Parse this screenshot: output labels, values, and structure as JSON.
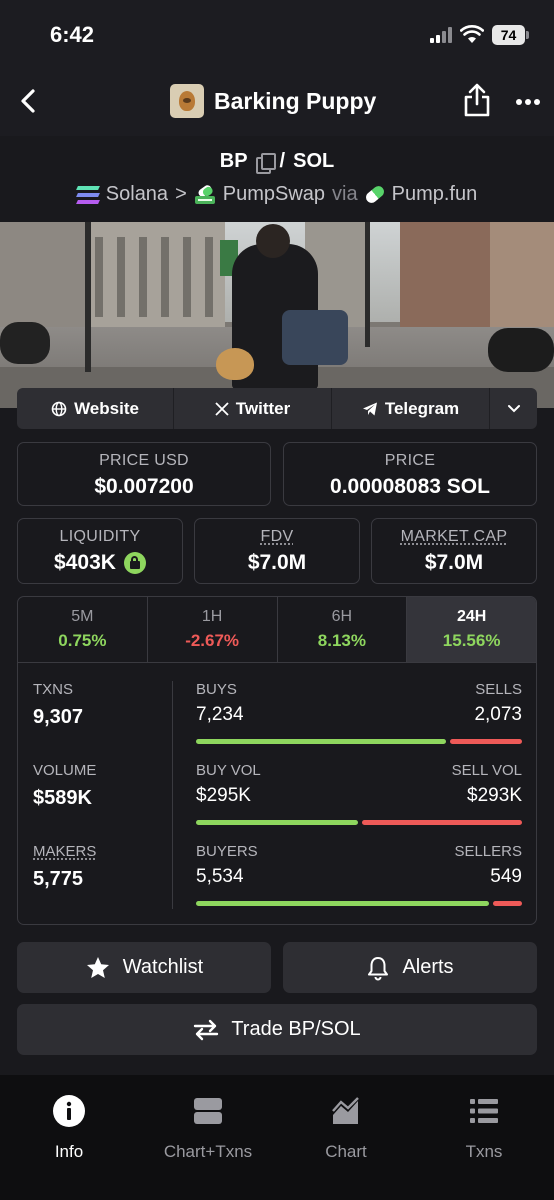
{
  "status_bar": {
    "time": "6:42",
    "battery": "74"
  },
  "nav": {
    "token_name": "Barking Puppy"
  },
  "pair": {
    "base": "BP",
    "separator": "/",
    "quote": "SOL",
    "chain": "Solana",
    "route_sep": ">",
    "dex": "PumpSwap",
    "via": "via",
    "launchpad": "Pump.fun"
  },
  "links": [
    {
      "label": "Website",
      "icon": "globe-icon"
    },
    {
      "label": "Twitter",
      "icon": "x-logo-icon"
    },
    {
      "label": "Telegram",
      "icon": "telegram-icon"
    }
  ],
  "price_usd": {
    "label": "PRICE USD",
    "value": "$0.007200"
  },
  "price_native": {
    "label": "PRICE",
    "value": "0.00008083 SOL"
  },
  "liquidity": {
    "label": "LIQUIDITY",
    "value": "$403K"
  },
  "fdv": {
    "label": "FDV",
    "value": "$7.0M"
  },
  "market_cap": {
    "label": "MARKET CAP",
    "value": "$7.0M"
  },
  "timeframes": [
    {
      "name": "5M",
      "change": "0.75%",
      "direction": "up"
    },
    {
      "name": "1H",
      "change": "-2.67%",
      "direction": "down"
    },
    {
      "name": "6H",
      "change": "8.13%",
      "direction": "up"
    },
    {
      "name": "24H",
      "change": "15.56%",
      "direction": "up",
      "active": true
    }
  ],
  "stats": {
    "txns": {
      "label": "TXNS",
      "value": "9,307"
    },
    "volume": {
      "label": "VOLUME",
      "value": "$589K"
    },
    "makers": {
      "label": "MAKERS",
      "value": "5,775"
    }
  },
  "splits": {
    "txns": {
      "left_label": "BUYS",
      "right_label": "SELLS",
      "left_value": "7,234",
      "right_value": "2,073",
      "left_share": 0.777
    },
    "volume": {
      "left_label": "BUY VOL",
      "right_label": "SELL VOL",
      "left_value": "$295K",
      "right_value": "$293K",
      "left_share": 0.502
    },
    "makers": {
      "left_label": "BUYERS",
      "right_label": "SELLERS",
      "left_value": "5,534",
      "right_value": "549",
      "left_share": 0.91
    }
  },
  "actions": {
    "watchlist": "Watchlist",
    "alerts": "Alerts",
    "trade": "Trade BP/SOL"
  },
  "tabs": [
    {
      "label": "Info",
      "icon": "info-icon",
      "active": true
    },
    {
      "label": "Chart+Txns",
      "icon": "split-view-icon"
    },
    {
      "label": "Chart",
      "icon": "area-chart-icon"
    },
    {
      "label": "Txns",
      "icon": "list-icon"
    }
  ],
  "colors": {
    "positive": "#8ed65e",
    "negative": "#ee5a58",
    "background": "#19191d",
    "surface": "#2e2e33"
  }
}
